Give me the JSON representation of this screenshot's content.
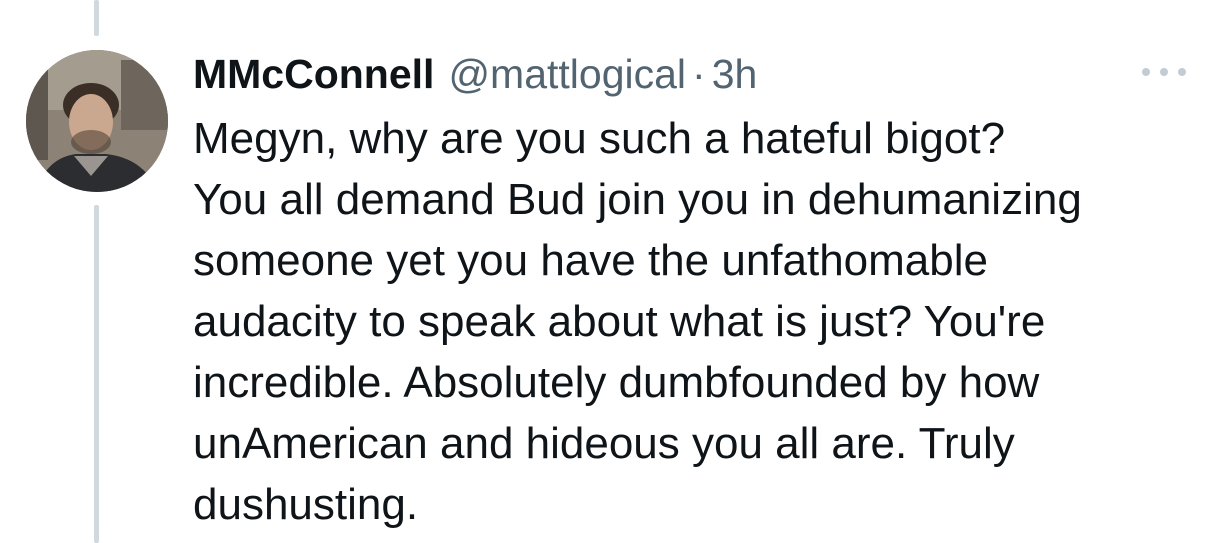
{
  "tweet": {
    "display_name": "MMcConnell",
    "handle": "@mattlogical",
    "separator": "·",
    "time": "3h",
    "text": "Megyn,  why are you such a hateful bigot?\nYou all demand Bud join you in dehumanizing\nsomeone yet you have the unfathomable\naudacity to speak about what is just? You're\nincredible. Absolutely dumbfounded by how\nunAmerican and hideous you all are. Truly\ndushusting.",
    "avatar_icon": "user-avatar",
    "more_icon": "more-horizontal-icon"
  },
  "colors": {
    "text": "#0f1419",
    "secondary": "#536471",
    "thread_line": "#cfd9de",
    "more_dots": "#c4ccd3"
  }
}
